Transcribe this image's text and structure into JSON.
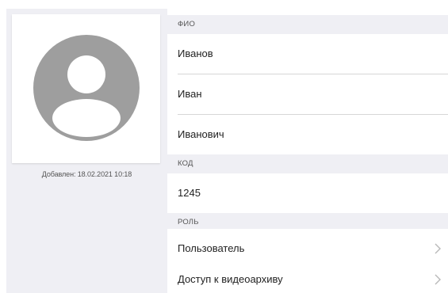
{
  "profile": {
    "added_label": "Добавлен: 18.02.2021 10:18"
  },
  "sections": {
    "fio": {
      "header": "ФИО",
      "last_name": "Иванов",
      "first_name": "Иван",
      "middle_name": "Иванович"
    },
    "code": {
      "header": "КОД",
      "value": "1245"
    },
    "role": {
      "header": "РОЛЬ",
      "items": [
        {
          "label": "Пользователь",
          "icon": "chevron-right-icon"
        },
        {
          "label": "Доступ к видеоархиву",
          "icon": "chevron-right-icon"
        }
      ]
    }
  },
  "colors": {
    "panel_bg": "#efeff4",
    "avatar_gray": "#9e9e9e",
    "divider": "#d6d6d6",
    "text": "#222222",
    "muted_text": "#555555",
    "chevron": "#b8b8b8"
  }
}
